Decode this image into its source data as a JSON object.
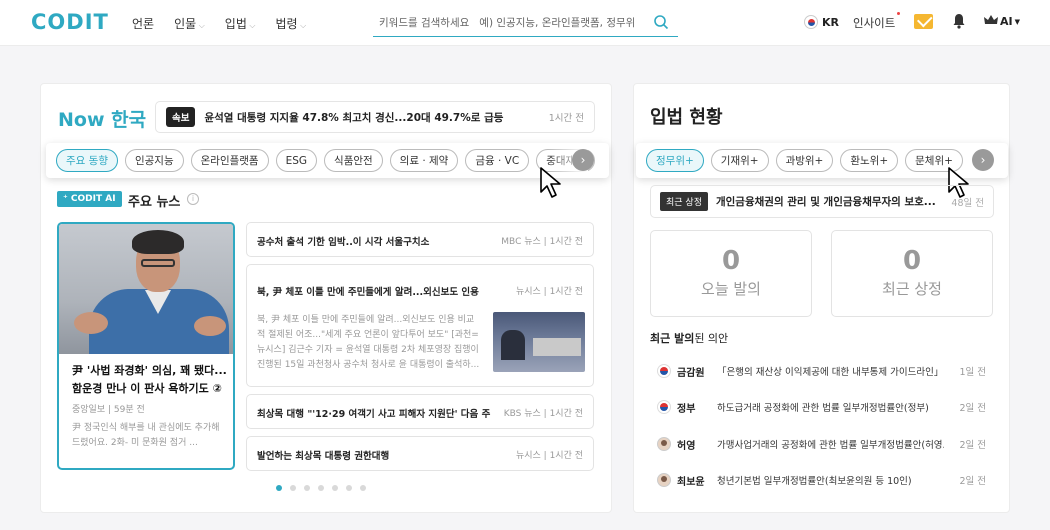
{
  "header": {
    "logo": "CODIT",
    "nav": [
      "언론",
      "인물",
      "입법",
      "법령"
    ],
    "search_placeholder": "키워드를 검색하세요   예) 인공지능, 온라인플랫폼, 정무위",
    "lang": "KR",
    "insight": "인사이트",
    "ai_label": "AI"
  },
  "now": {
    "title_en": "Now",
    "title_ko": "한국",
    "breaking_badge": "속보",
    "breaking_text": "윤석열 대통령 지지율 47.8% 최고치 경신...20대 49.7%로 급등",
    "breaking_time": "1시간 전",
    "chips": [
      "주요 동향",
      "인공지능",
      "온라인플랫폼",
      "ESG",
      "식품안전",
      "의료 · 제약",
      "금융 · VC",
      "중대재해"
    ],
    "codit_ai_badge": "CODIT AI",
    "main_news_label": "주요 뉴스",
    "info_icon": "i"
  },
  "feature": {
    "title": "尹 '사법 좌경화' 의심, 꽤 됐다... 함운경 만나 이 판사 욕하기도 ②",
    "source": "중앙일보",
    "time": "59분 전",
    "body": "尹 정국인식 해부를 내 관심에도 추가해드렸어요. 2화- 미 문화원 점거 ..."
  },
  "news": [
    {
      "title": "공수처 출석 기한 임박..이 시각 서울구치소",
      "source": "MBC 뉴스",
      "time": "1시간 전"
    },
    {
      "title": "북, 尹 체포 이틀 만에 주민들에게 알려...외신보도 인용",
      "source": "뉴시스",
      "time": "1시간 전",
      "body": "북, 尹 체포 이틀 만에 주민들에 알려...외신보도 인용 비교적 절제된 어조...\"세계 주요 언론이 앞다투어 보도\" [과천=뉴시스] 김근수 기자 = 윤석열 대통령 2차 체포영장 집행이 진행된 15일 과천청사 공수처 청사로 윤 대통령이 출석하..."
    },
    {
      "title": "최상목 대행 \"'12·29 여객기 사고 피해자 지원단' 다음 주 ...",
      "source": "KBS 뉴스",
      "time": "1시간 전"
    },
    {
      "title": "발언하는 최상목 대통령 권한대행",
      "source": "뉴시스",
      "time": "1시간 전"
    }
  ],
  "legislation": {
    "title": "입법 현황",
    "chips": [
      "정무위+",
      "기재위+",
      "과방위+",
      "환노위+",
      "문체위+"
    ],
    "breaking_badge": "최근 상정",
    "breaking_text": "개인금융채권의 관리 및 개인금융채무자의 보호...",
    "breaking_time": "48일 전",
    "stats": [
      {
        "num": "0",
        "label": "오늘 발의"
      },
      {
        "num": "0",
        "label": "최근 상정"
      }
    ],
    "recent_bold": "최근 발의",
    "recent_rest": "된 의안",
    "bills": [
      {
        "org": "금감원",
        "title": "「은행의 재산상 이익제공에 대한 내부통제 가이드라인」...",
        "time": "1일 전",
        "icon": "korea-emblem-icon"
      },
      {
        "org": "정부",
        "title": "하도급거래 공정화에 관한 법률 일부개정법률안(정부)",
        "time": "2일 전",
        "icon": "korea-emblem-icon"
      },
      {
        "org": "허영",
        "title": "가맹사업거래의 공정화에 관한 법률 일부개정법률안(허영...",
        "time": "2일 전",
        "icon": "person-avatar-icon"
      },
      {
        "org": "최보윤",
        "title": "청년기본법 일부개정법률안(최보윤의원 등 10인)",
        "time": "2일 전",
        "icon": "person-avatar-icon"
      }
    ]
  },
  "colors": {
    "accent": "#2fa9c2",
    "mail": "#f5b731"
  }
}
